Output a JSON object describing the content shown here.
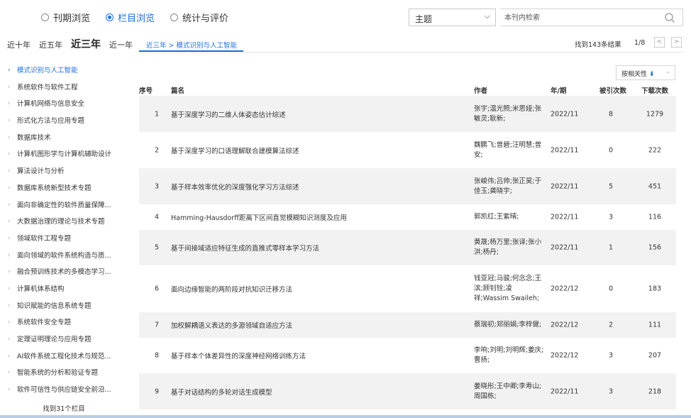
{
  "view_modes": [
    {
      "label": "刊期浏览",
      "selected": false
    },
    {
      "label": "栏目浏览",
      "selected": true
    },
    {
      "label": "统计与评价",
      "selected": false
    }
  ],
  "search": {
    "field_select": "主题",
    "placeholder": "本刊内检索"
  },
  "year_filters": [
    "近十年",
    "近五年",
    "近三年",
    "近一年"
  ],
  "active_year_filter": "近三年",
  "breadcrumb": "近三年 > 模式识别与人工智能",
  "results": {
    "count_text": "找到143条结果",
    "page_text": "1/8",
    "prev": "<",
    "next": ">"
  },
  "sidebar": {
    "items": [
      "模式识别与人工智能",
      "系统软件与软件工程",
      "计算机网络与信息安全",
      "形式化方法与应用专题",
      "数据库技术",
      "计算机图形学与计算机辅助设计",
      "算法设计与分析",
      "数据库系统新型技术专题",
      "面向非确定性的软件质量保障...",
      "大数据治理的理论与技术专题",
      "领域软件工程专题",
      "面向领域的软件系统构造与质...",
      "融合预训练技术的多模态学习...",
      "计算机体系结构",
      "知识赋能的信息系统专题",
      "系统软件安全专题",
      "定理证明理论与应用专题",
      "AI软件系统工程化技术与规范...",
      "智能系统的分析和验证专题",
      "软件可信性与供应链安全前沿..."
    ],
    "active_index": 0,
    "footer": "找到31个栏目"
  },
  "sort": {
    "label": "按相关性",
    "arrow": "⬇"
  },
  "table": {
    "headers": {
      "no": "序号",
      "title": "篇名",
      "author": "作者",
      "year": "年/期",
      "cite": "被引次数",
      "download": "下载次数"
    },
    "rows": [
      {
        "no": "1",
        "title": "基于深度学习的二维人体姿态估计综述",
        "author": "张宇;温光照;米思娅;张敏灵;耿新;",
        "year": "2022/11",
        "cite": "8",
        "download": "1279"
      },
      {
        "no": "2",
        "title": "基于深度学习的口语理解联合建模算法综述",
        "author": "魏鹏飞;曾碧;汪明慧;曾安;",
        "year": "2022/11",
        "cite": "0",
        "download": "222"
      },
      {
        "no": "3",
        "title": "基于样本效率优化的深度强化学习方法综述",
        "author": "张峻伟;吕帅;张正昊;于佳玉;龚晓宇;",
        "year": "2022/11",
        "cite": "5",
        "download": "451"
      },
      {
        "no": "4",
        "title": "Hamming-Hausdorff距离下区间直觉模糊知识测度及应用",
        "author": "郭凯红;王紫晴;",
        "year": "2022/11",
        "cite": "3",
        "download": "116"
      },
      {
        "no": "5",
        "title": "基于间接域适应特征生成的直推式零样本学习方法",
        "author": "黄晟;杨万里;张译;张小洪;杨丹;",
        "year": "2022/11",
        "cite": "1",
        "download": "156"
      },
      {
        "no": "6",
        "title": "面向边缘智能的两阶段对抗知识迁移方法",
        "author": "钱亚冠;马骏;何念念;王滨;顾钊铨;凌祥;Wassim Swaileh;",
        "year": "2022/12",
        "cite": "0",
        "download": "183"
      },
      {
        "no": "7",
        "title": "加权解耦语义表达的多源领域自适应方法",
        "author": "蔡瑞初;郑丽娟;李梓健;",
        "year": "2022/12",
        "cite": "2",
        "download": "111"
      },
      {
        "no": "8",
        "title": "基于样本个体差异性的深度神经网络训练方法",
        "author": "李响;刘明;刘明辉;姜庆;曹扬;",
        "year": "2022/12",
        "cite": "3",
        "download": "207"
      },
      {
        "no": "9",
        "title": "基于对话结构的多轮对话生成模型",
        "author": "姜晓彤;王中卿;李寿山;周国栋;",
        "year": "2022/11",
        "cite": "3",
        "download": "218"
      }
    ]
  }
}
